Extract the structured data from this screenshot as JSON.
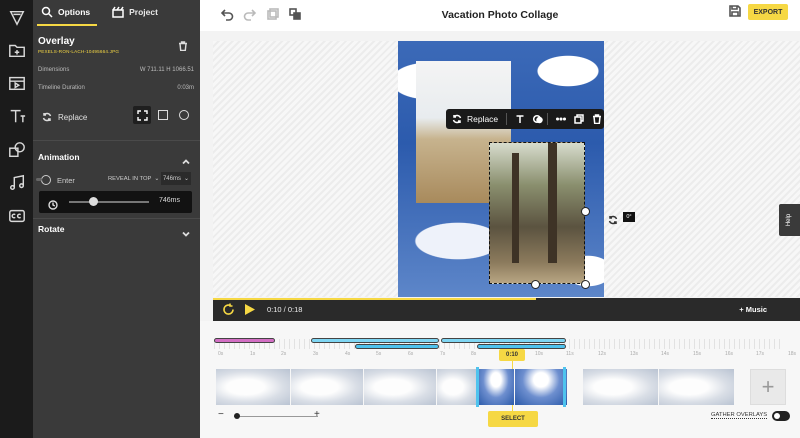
{
  "tabs": {
    "options": "Options",
    "project": "Project"
  },
  "panel": {
    "title": "Overlay",
    "filename": "PEXELS-RON-LACH-10495664.JPG",
    "dimensions_label": "Dimensions",
    "dimensions_value": "W 711.11  H 1066.51",
    "duration_label": "Timeline Duration",
    "duration_value": "0:03m",
    "replace_label": "Replace",
    "animation_title": "Animation",
    "enter_label": "Enter",
    "animation_style": "REVEAL IN TOP",
    "animation_ms": "746ms",
    "slider_value": "746ms",
    "slider_fraction": 0.3,
    "rotate_title": "Rotate"
  },
  "header": {
    "title": "Vacation Photo Collage",
    "export_label": "EXPORT"
  },
  "context_menu": {
    "replace_label": "Replace"
  },
  "canvas": {
    "rotation_badge": "0°",
    "help_label": "Help"
  },
  "playback": {
    "time": "0:10  /  0:18",
    "music_label": "+ Music",
    "progress_fraction": 0.55
  },
  "timeline": {
    "tick_labels": [
      "0s",
      "1s",
      "2s",
      "3s",
      "4s",
      "5s",
      "6s",
      "7s",
      "8s",
      "9s",
      "10s",
      "11s",
      "12s",
      "13s",
      "14s",
      "15s",
      "16s",
      "17s",
      "18s"
    ],
    "playhead": "0:10",
    "select_label": "SELECT",
    "gather_label": "GATHER OVERLAYS"
  },
  "colors": {
    "accent": "#f6d844",
    "selection": "#4fc3ee",
    "audio": "#d36fc4",
    "panel": "#3a3a3a"
  }
}
